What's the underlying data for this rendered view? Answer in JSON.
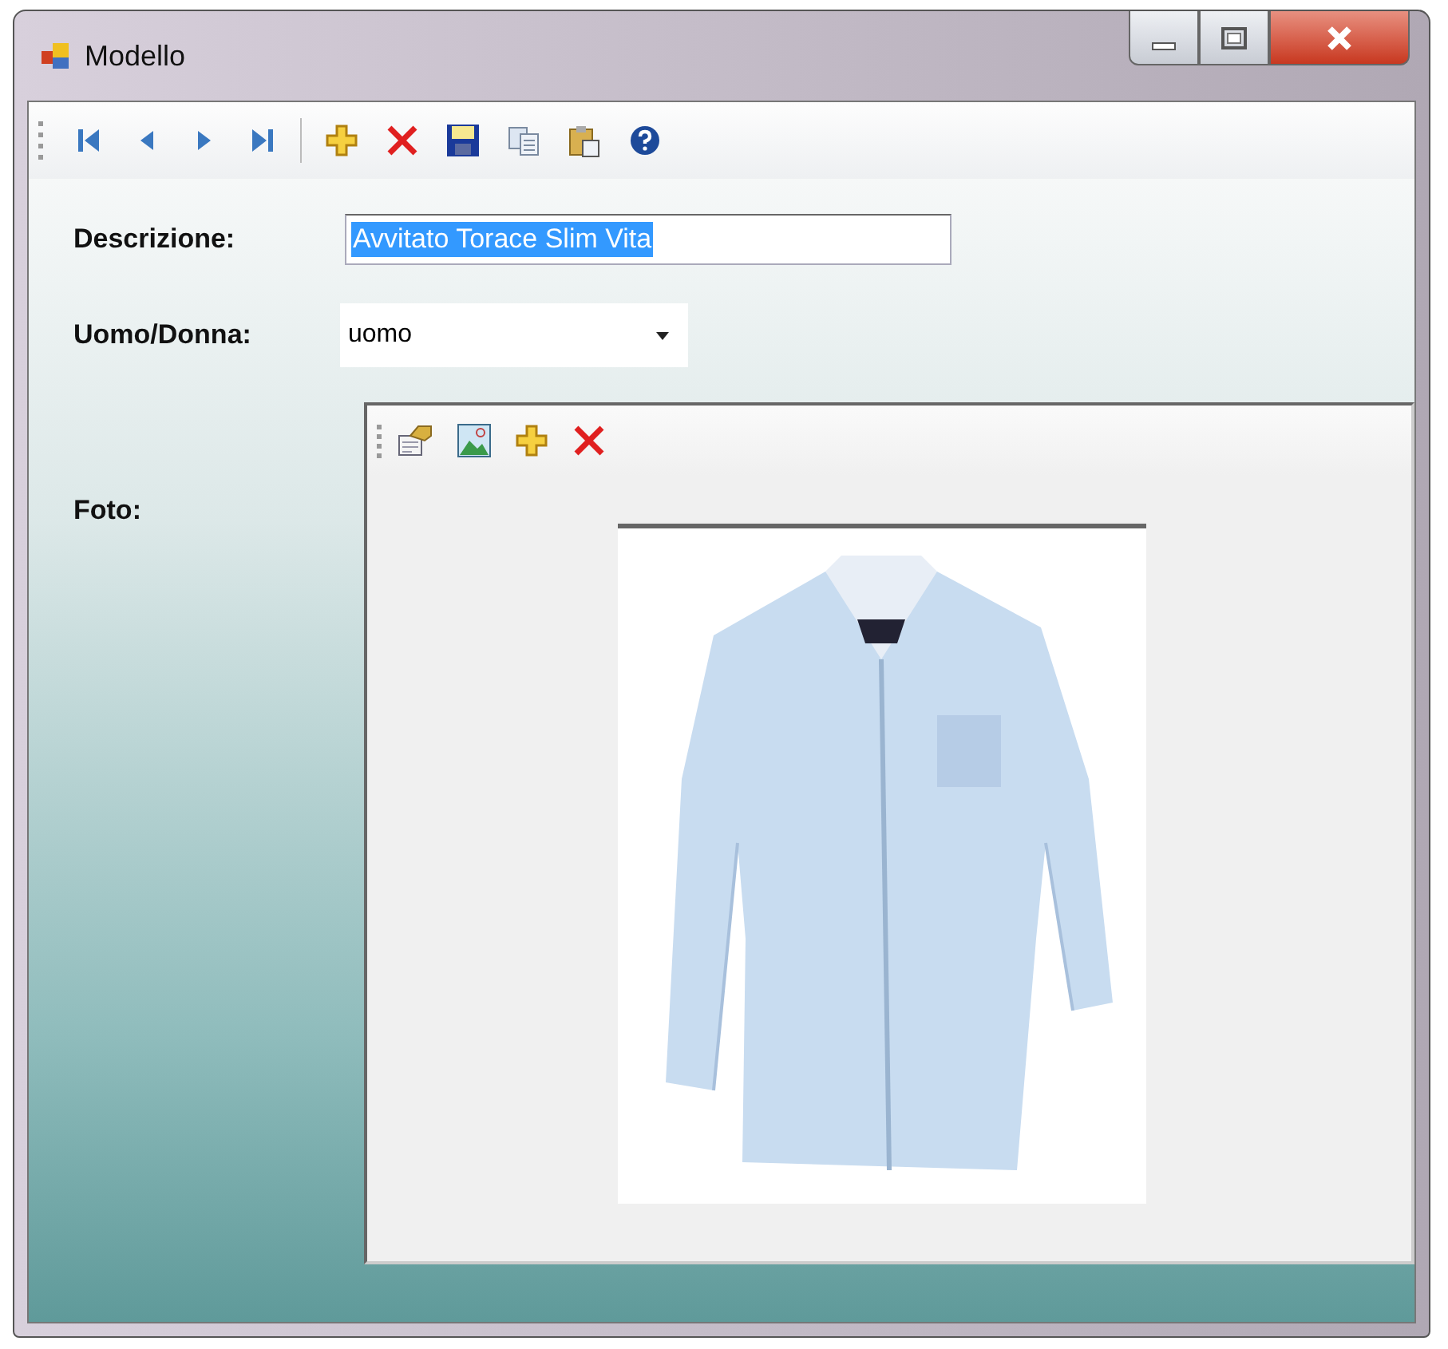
{
  "window": {
    "title": "Modello"
  },
  "form": {
    "description": {
      "label": "Descrizione:",
      "value": "Avvitato Torace Slim Vita",
      "selected": true
    },
    "gender": {
      "label": "Uomo/Donna:",
      "value": "uomo"
    },
    "photo": {
      "label": "Foto:",
      "kind": "picture"
    }
  }
}
